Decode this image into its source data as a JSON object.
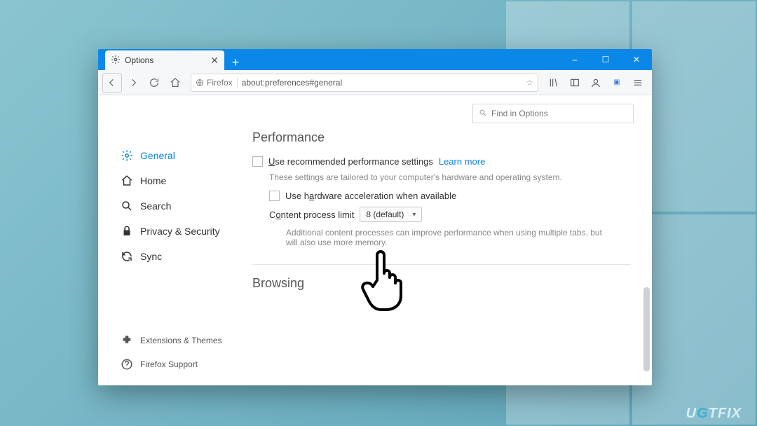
{
  "desktop": {
    "watermark_left": "U",
    "watermark_right": "TFIX"
  },
  "window": {
    "tab_label": "Options",
    "win_controls": {
      "minimize": "–",
      "maximize": "☐",
      "close": "✕"
    },
    "newtab_label": "+"
  },
  "toolbar": {
    "identity_label": "Firefox",
    "url": "about:preferences#general"
  },
  "search": {
    "placeholder": "Find in Options"
  },
  "sidebar": {
    "items": [
      {
        "label": "General"
      },
      {
        "label": "Home"
      },
      {
        "label": "Search"
      },
      {
        "label": "Privacy & Security"
      },
      {
        "label": "Sync"
      }
    ],
    "bottom": [
      {
        "label": "Extensions & Themes"
      },
      {
        "label": "Firefox Support"
      }
    ]
  },
  "main": {
    "performance": {
      "title": "Performance",
      "use_recommended": "Use recommended performance settings",
      "learn_more": "Learn more",
      "tailored": "These settings are tailored to your computer's hardware and operating system.",
      "use_hw_accel": "Use hardware acceleration when available",
      "content_process_limit": "Content process limit",
      "process_limit_value": "8 (default)",
      "process_help": "Additional content processes can improve performance when using multiple tabs, but will also use more memory."
    },
    "browsing": {
      "title": "Browsing"
    }
  }
}
